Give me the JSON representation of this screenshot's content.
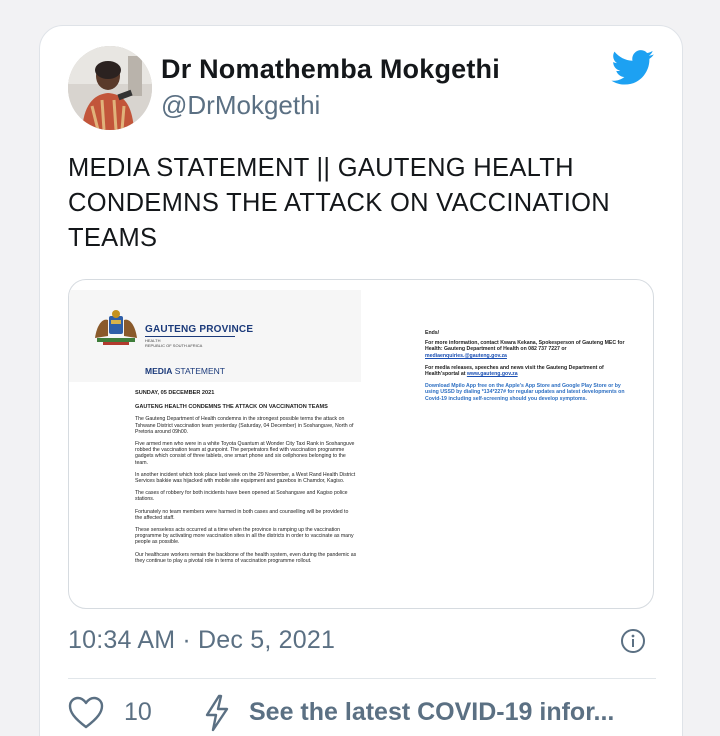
{
  "tweet": {
    "author_name": "Dr Nomathemba Mokgethi",
    "author_handle": "@DrMokgethi",
    "text": "MEDIA STATEMENT || GAUTENG HEALTH CONDEMNS THE ATTACK ON VACCINATION TEAMS",
    "timestamp": "10:34 AM · Dec 5, 2021",
    "likes_count": "10",
    "covid_label": "See the latest COVID-19 infor..."
  },
  "document": {
    "org_title": "GAUTENG PROVINCE",
    "org_sub1": "HEALTH",
    "org_sub2": "REPUBLIC OF SOUTH AFRICA",
    "statement_label_bold": "MEDIA",
    "statement_label_rest": " STATEMENT",
    "date": "SUNDAY, 05 DECEMBER 2021",
    "headline": "GAUTENG HEALTH CONDEMNS THE ATTACK ON  VACCINATION TEAMS",
    "paragraphs": [
      "The Gauteng Department of Health condemns in the strongest possible terms the attack on Tshwane District vaccination team yesterday (Saturday, 04 December) in Soshanguve, North of Pretoria around 09h00.",
      "Five armed men who were in a white Toyota Quantum at Wonder City Taxi Rank in Soshanguve robbed the vaccination team at gunpoint. The perpetrators fled with vaccination programme gadgets which consist of three tablets, one smart phone and six cellphones belonging to the team.",
      "In another incident which took place last week on the 29 November, a West Rand Health District Services bakkie was hijacked with mobile site equipment and gazebos in Chamdor, Kagiso.",
      "The cases of robbery for both incidents have been opened at Soshanguve and Kagiso police stations.",
      "Fortunately no team members were harmed in both cases and counselling will be provided to the affected staff.",
      "These senseless acts occurred at a time when the province is ramping up the vaccination programme by activating more vaccination sites in all the districts in order to vaccinate as many people as possible.",
      "Our healthcare workers remain the backbone of the health system, even during the pandemic as they continue to play a pivotal role in terms of vaccination programme rollout."
    ],
    "ends": "Ends/",
    "contact_text": "For more information, contact Kwara Kekana, Spokesperson of Gauteng MEC for Health: Gauteng Department of Health on 082 737 7227 or ",
    "contact_email": "mediaenquiries.@gauteng.gov.za",
    "releases_text": "For media releases, speeches and news visit the Gauteng Department of Health'sportal at ",
    "releases_link": "www.gauteng.gov.za",
    "app_text": "Download Mpilo App free on the Apple's App Store and Google Play Store or by using USSD by dialing *134*227# for regular updates and latest developments on Covid-19 including self-screening should you develop symptoms."
  },
  "colors": {
    "twitter_blue": "#1da1f2",
    "text_primary": "#14171a",
    "text_secondary": "#5b7083"
  },
  "icons": {
    "brand": "twitter-bird-icon",
    "info": "info-icon",
    "like": "heart-icon",
    "covid": "lightning-bolt-icon"
  }
}
